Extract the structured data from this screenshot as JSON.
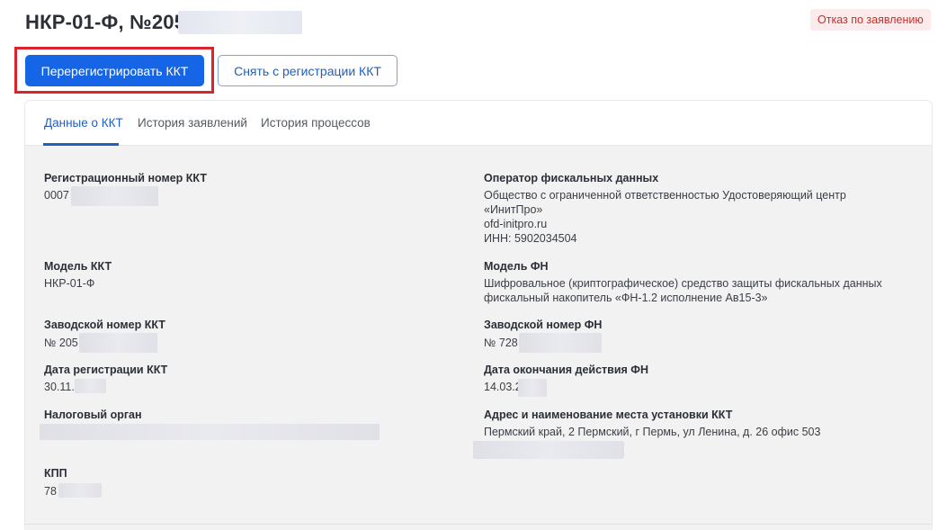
{
  "header": {
    "title": "НКР-01-Ф, №205",
    "status": "Отказ по заявлению"
  },
  "actions": {
    "reregister_label": "Перерегистрировать ККТ",
    "deregister_label": "Снять с регистрации ККТ"
  },
  "tabs": [
    {
      "label": "Данные о ККТ",
      "active": true
    },
    {
      "label": "История заявлений",
      "active": false
    },
    {
      "label": "История процессов",
      "active": false
    }
  ],
  "left": {
    "reg_number": {
      "label": "Регистрационный номер ККТ",
      "value": "0007"
    },
    "model": {
      "label": "Модель ККТ",
      "value": "НКР-01-Ф"
    },
    "serial": {
      "label": "Заводской номер ККТ",
      "value": "№ 205"
    },
    "reg_date": {
      "label": "Дата регистрации ККТ",
      "value": "30.11."
    },
    "tax_office": {
      "label": "Налоговый орган",
      "value": ""
    },
    "kpp": {
      "label": "КПП",
      "value": "78"
    }
  },
  "right": {
    "ofd": {
      "label": "Оператор фискальных данных",
      "line1": "Общество с ограниченной ответственностью Удостоверяющий центр",
      "line2": "«ИнитПро»",
      "line3": "ofd-initpro.ru",
      "line4": "ИНН: 5902034504"
    },
    "fn_model": {
      "label": "Модель ФН",
      "line1": "Шифровальное (криптографическое) средство защиты фискальных данных",
      "line2": "фискальный накопитель «ФН-1.2 исполнение Ав15-3»"
    },
    "fn_serial": {
      "label": "Заводской номер ФН",
      "value": "№ 728"
    },
    "fn_expiry": {
      "label": "Дата окончания действия ФН",
      "value": "14.03.2"
    },
    "address": {
      "label": "Адрес и наименование места установки ККТ",
      "value": "Пермский край, 2 Пермский, г Пермь, ул Ленина, д. 26 офис 503"
    }
  },
  "colors": {
    "primary": "#1565e6",
    "accent_text": "#1f5fbf",
    "highlight": "#d9232d",
    "status_bg": "#fdeaea",
    "status_text": "#c9302c"
  }
}
